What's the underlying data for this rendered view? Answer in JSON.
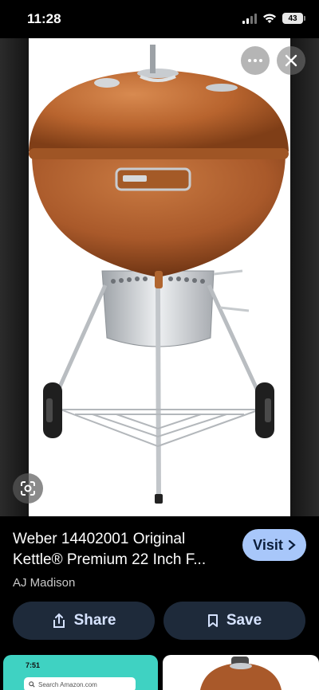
{
  "status_bar": {
    "time": "11:28",
    "battery": "43",
    "icons": [
      "signal-icon",
      "wifi-icon",
      "battery-icon"
    ]
  },
  "image_viewer": {
    "image_subject": "Weber kettle charcoal grill (copper lid)",
    "buttons": [
      "more-options-icon",
      "close-icon",
      "google-lens-icon"
    ],
    "colors": {
      "grill_lid": "#b8642e",
      "background": "#ffffff"
    }
  },
  "result": {
    "title": "Weber 14402001 Original Kettle® Premium 22 Inch F...",
    "source": "AJ Madison",
    "visit_label": "Visit",
    "share_label": "Share",
    "save_label": "Save"
  },
  "related": {
    "left": {
      "time": "7:51",
      "search_placeholder": "Search Amazon.com"
    }
  },
  "accent": "#a8c7fa"
}
